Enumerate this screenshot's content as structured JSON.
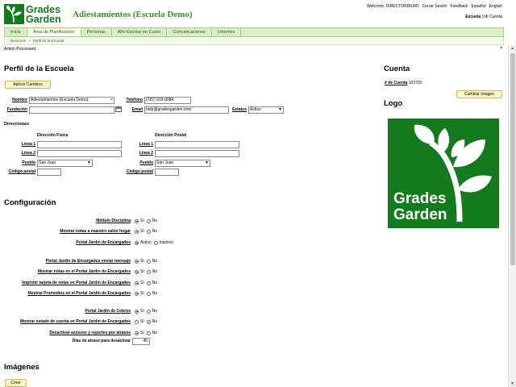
{
  "header": {
    "logo_line1": "Grades",
    "logo_line2": "Garden",
    "school_name": "Adiestamientos (Escuela Demo)",
    "top_links": [
      "Welcome: DIRECTORDEMO",
      "Cerrar Sesión",
      "Feedback",
      "Español",
      "English"
    ],
    "module_active": "Escuela",
    "module_sep": "|",
    "module_other": "Mi Cuenta"
  },
  "nav": {
    "tabs": [
      "Inicio",
      "Área de Planificación",
      "Personas",
      "Año Escolar en Curso",
      "Comunicaciones",
      "Informes"
    ],
    "active_index": 1
  },
  "breadcrumb": {
    "items": [
      "Resumen",
      "Perfil de la Escuela"
    ],
    "separator": ">"
  },
  "message": {
    "text": "Action Processed.",
    "close": "×"
  },
  "profile": {
    "title": "Perfil de la Escuela",
    "apply_button": "Aplicar Cambios",
    "nombre_label": "Nombre",
    "nombre_value": "Adiestamientos (Escuela Demo)",
    "telefono_label": "Teléfono",
    "telefono_value": "(787) 919-0084",
    "fundacion_label": "Fundación",
    "fundacion_value": "",
    "email_label": "Email",
    "email_value": "help@gradesgarden.com",
    "estatus_label": "Estatus",
    "estatus_value": "Activo"
  },
  "addresses": {
    "title": "Direcciones",
    "fisica_title": "Dirección Física",
    "postal_title": "Dirección Postal",
    "linea1_label": "Línea 1",
    "linea2_label": "Línea 2",
    "pueblo_label": "Pueblo",
    "codigo_label": "Código postal",
    "fisica_pueblo": "San Juan",
    "postal_pueblo": "San Juan"
  },
  "config": {
    "title": "Configuración",
    "yes": "Sí",
    "no": "No",
    "activo": "Activo",
    "inactivo": "Inactivo",
    "rows": [
      {
        "label": "Módulo Disciplina",
        "selected": "yes"
      },
      {
        "label": "Mostrar notas a maestro salón hogar",
        "selected": "yes"
      },
      {
        "label": "Portal Jardín de Encargados",
        "selected": "activo"
      },
      {
        "label": "Portal Jardín de Encargados enviar mensaje",
        "selected": "yes"
      },
      {
        "label": "Mostrar notas en el Portal Jardín de Encargados",
        "selected": "yes"
      },
      {
        "label": "Imprimir tarjeta de notas en Portal Jardín de Encargados",
        "selected": "yes"
      },
      {
        "label": "Mostrar Promedios en el Portal Jardín de Encargados",
        "selected": "yes"
      },
      {
        "label": "Portal Jardín de Cobros",
        "selected": "yes"
      },
      {
        "label": "Mostrar estado de cuenta en Portal Jardín de Encargados",
        "selected": "no"
      },
      {
        "label": "Desactivar accesos y reportes por atrasos",
        "selected": "yes"
      }
    ],
    "dias_label": "Días de atraso para desactivar",
    "dias_value": "45"
  },
  "images": {
    "title": "Imágenes",
    "create_button": "Crear"
  },
  "account": {
    "title": "Cuenta",
    "number_label": "# de Cuenta",
    "number_value": "103720",
    "change_image_button": "Cambiar Imagen",
    "logo_title": "Logo"
  },
  "colors": {
    "brand_green": "#137a1e",
    "nav_bg": "#d8efc4",
    "button_bg": "#fdf6c8"
  }
}
